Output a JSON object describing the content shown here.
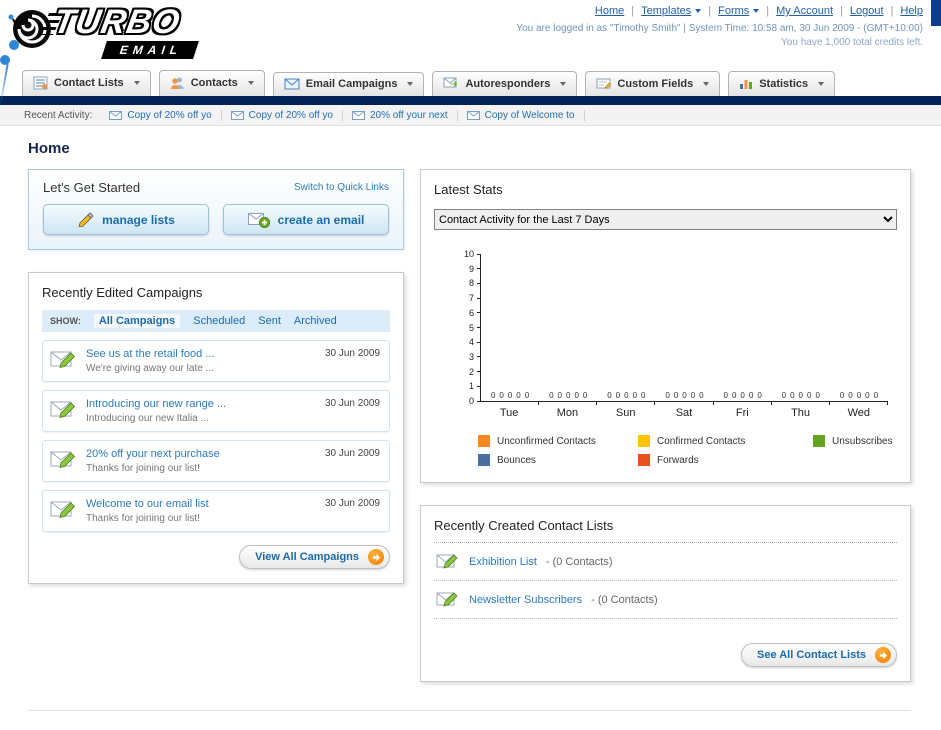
{
  "logo": {
    "title": "TURBO",
    "subtitle": "EMAIL"
  },
  "header": {
    "links": [
      {
        "label": "Home"
      },
      {
        "label": "Templates"
      },
      {
        "label": "Forms"
      },
      {
        "label": "My Account"
      },
      {
        "label": "Logout"
      },
      {
        "label": "Help"
      }
    ],
    "login_info": "You are logged in as \"Timothy Smith\" | System Time: 10:58 am, 30 Jun 2009 - (GMT+10:00)",
    "credits_info": "You have 1,000 total credits left."
  },
  "nav": {
    "tabs": [
      {
        "label": "Contact Lists",
        "icon": "contact-lists-icon"
      },
      {
        "label": "Contacts",
        "icon": "contacts-icon"
      },
      {
        "label": "Email Campaigns",
        "icon": "email-campaigns-icon"
      },
      {
        "label": "Autoresponders",
        "icon": "autoresponders-icon"
      },
      {
        "label": "Custom Fields",
        "icon": "custom-fields-icon"
      },
      {
        "label": "Statistics",
        "icon": "statistics-icon"
      }
    ]
  },
  "recent_activity": {
    "label": "Recent Activity:",
    "items": [
      {
        "text": "Copy of 20% off yo"
      },
      {
        "text": "Copy of 20% off yo"
      },
      {
        "text": "20% off your next"
      },
      {
        "text": "Copy of Welcome to"
      }
    ]
  },
  "page": {
    "title": "Home"
  },
  "get_started": {
    "title": "Let's Get Started",
    "switch_link": "Switch to Quick Links",
    "manage_lists_label": "manage lists",
    "create_email_label": "create an email"
  },
  "campaigns": {
    "title": "Recently Edited Campaigns",
    "show_label": "SHOW:",
    "filters": [
      "All Campaigns",
      "Scheduled",
      "Sent",
      "Archived"
    ],
    "active_filter": "All Campaigns",
    "items": [
      {
        "title": "See us at the retail food ...",
        "subtitle": "We're giving away our late ...",
        "date": "30 Jun 2009"
      },
      {
        "title": "Introducing our new range ...",
        "subtitle": "Introducing our new Italia ...",
        "date": "30 Jun 2009"
      },
      {
        "title": "20% off your next purchase",
        "subtitle": "Thanks for joining our list!",
        "date": "30 Jun 2009"
      },
      {
        "title": "Welcome to our email list",
        "subtitle": "Thanks for joining our list!",
        "date": "30 Jun 2009"
      }
    ],
    "view_all_label": "View All Campaigns"
  },
  "latest_stats": {
    "title": "Latest Stats",
    "dropdown_value": "Contact Activity for the Last 7 Days",
    "chart_data": {
      "type": "bar",
      "title": "Contact Activity for the Last 7 Days",
      "categories": [
        "Tue",
        "Mon",
        "Sun",
        "Sat",
        "Fri",
        "Thu",
        "Wed"
      ],
      "series": [
        {
          "name": "Unconfirmed Contacts",
          "color": "#f6891f",
          "values": [
            0,
            0,
            0,
            0,
            0,
            0,
            0
          ]
        },
        {
          "name": "Confirmed Contacts",
          "color": "#fdc500",
          "values": [
            0,
            0,
            0,
            0,
            0,
            0,
            0
          ]
        },
        {
          "name": "Unsubscribes",
          "color": "#64a422",
          "values": [
            0,
            0,
            0,
            0,
            0,
            0,
            0
          ]
        },
        {
          "name": "Bounces",
          "color": "#4a6d9e",
          "values": [
            0,
            0,
            0,
            0,
            0,
            0,
            0
          ]
        },
        {
          "name": "Forwards",
          "color": "#e8501e",
          "values": [
            0,
            0,
            0,
            0,
            0,
            0,
            0
          ]
        }
      ],
      "xlabel": "",
      "ylabel": "",
      "ylim": [
        0,
        10
      ],
      "grid": false,
      "legend_position": "bottom"
    }
  },
  "contact_lists": {
    "title": "Recently Created Contact Lists",
    "items": [
      {
        "name": "Exhibition List",
        "detail": "- (0 Contacts)"
      },
      {
        "name": "Newsletter Subscribers",
        "detail": "- (0 Contacts)"
      }
    ],
    "see_all_label": "See All Contact Lists"
  }
}
